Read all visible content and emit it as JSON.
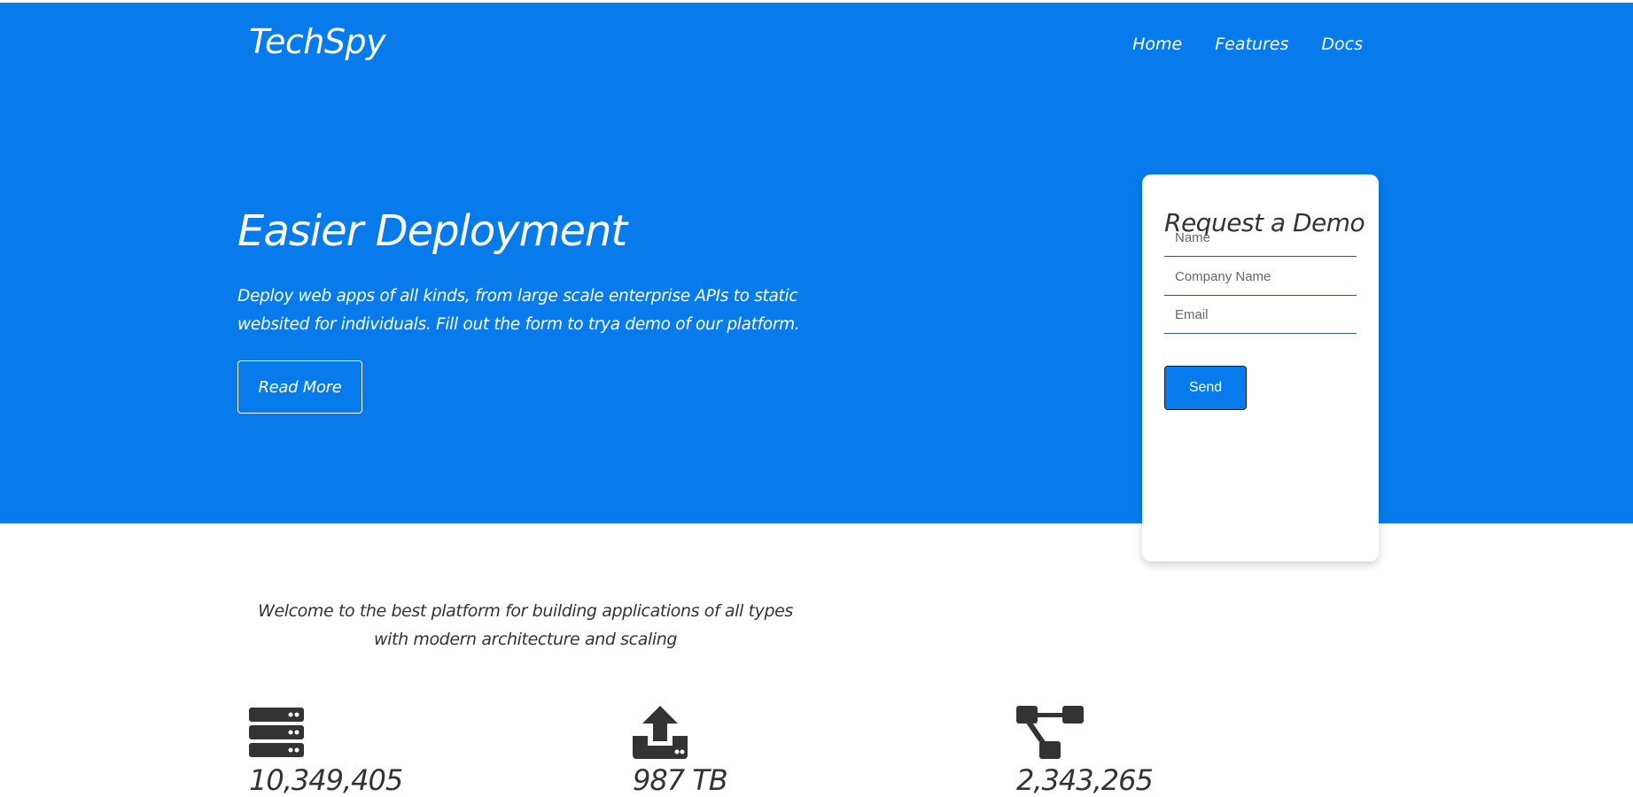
{
  "header": {
    "logo": "TechSpy",
    "nav": [
      "Home",
      "Features",
      "Docs"
    ]
  },
  "hero": {
    "title": "Easier Deployment",
    "description": "Deploy web apps of all kinds, from large scale enterprise APIs to static websited for individuals. Fill out the form to trya demo of our platform.",
    "cta_label": "Read More"
  },
  "demo_form": {
    "title": "Request a Demo",
    "name_placeholder": "Name",
    "company_placeholder": "Company Name",
    "email_placeholder": "Email",
    "send_label": "Send"
  },
  "welcome": {
    "text": "Welcome to the best platform for building applications of all types with modern architecture and scaling"
  },
  "stats": [
    {
      "icon": "server-icon",
      "value": "10,349,405"
    },
    {
      "icon": "upload-icon",
      "value": "987 TB"
    },
    {
      "icon": "network-icon",
      "value": "2,343,265"
    }
  ],
  "colors": {
    "brand": "#077bec",
    "text_dark": "#333333",
    "icon": "#333333"
  }
}
